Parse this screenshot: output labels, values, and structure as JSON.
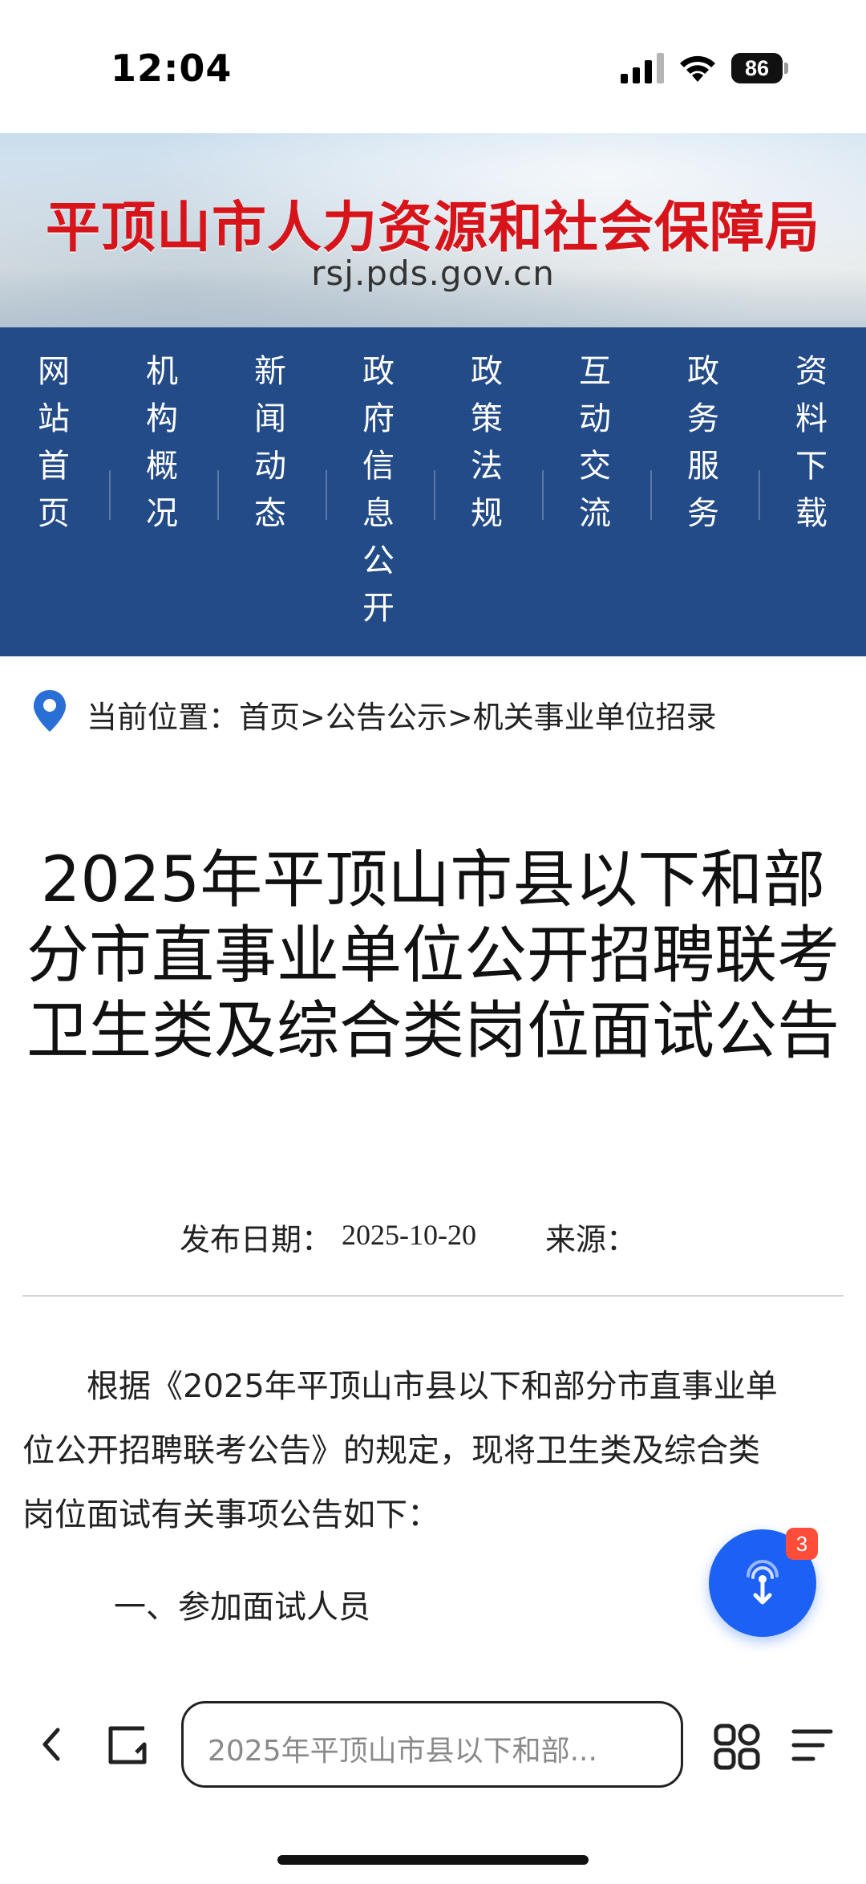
{
  "status_bar": {
    "time": "12:04",
    "battery": "86",
    "icons": [
      "signal-icon",
      "wifi-icon",
      "battery-icon"
    ]
  },
  "banner": {
    "title": "平顶山市人力资源和社会保障局",
    "url": "rsj.pds.gov.cn",
    "title_color": "#d8141b"
  },
  "nav": {
    "background": "#234b88",
    "items": [
      {
        "label": "网站首页"
      },
      {
        "label": "机构概况"
      },
      {
        "label": "新闻动态"
      },
      {
        "label": "政府信息公开"
      },
      {
        "label": "政策法规"
      },
      {
        "label": "互动交流"
      },
      {
        "label": "政务服务"
      },
      {
        "label": "资料下载"
      }
    ]
  },
  "breadcrumb": {
    "icon": "location-pin-icon",
    "text": "当前位置：首页>公告公示>机关事业单位招录"
  },
  "article": {
    "title": "2025年平顶山市县以下和部分市直事业单位公开招聘联考卫生类及综合类岗位面试公告",
    "date_label": "发布日期：",
    "date": "2025-10-20",
    "source_label": "来源：",
    "paragraph_lines": [
      "　　根据《2025年平顶山市县以下和部分市直事业单",
      "位公开招聘联考公告》的规定，现将卫生类及综合类",
      "岗位面试有关事项公告如下："
    ],
    "section_heading": "一、参加面试人员"
  },
  "floating_button": {
    "icon": "ai-assistant-icon",
    "badge": "3",
    "color": "#1c61f3"
  },
  "toolbar": {
    "url_text": "2025年平顶山市县以下和部...",
    "icons": [
      "back-icon",
      "tabs-icon",
      "grid-icon",
      "menu-icon"
    ]
  }
}
